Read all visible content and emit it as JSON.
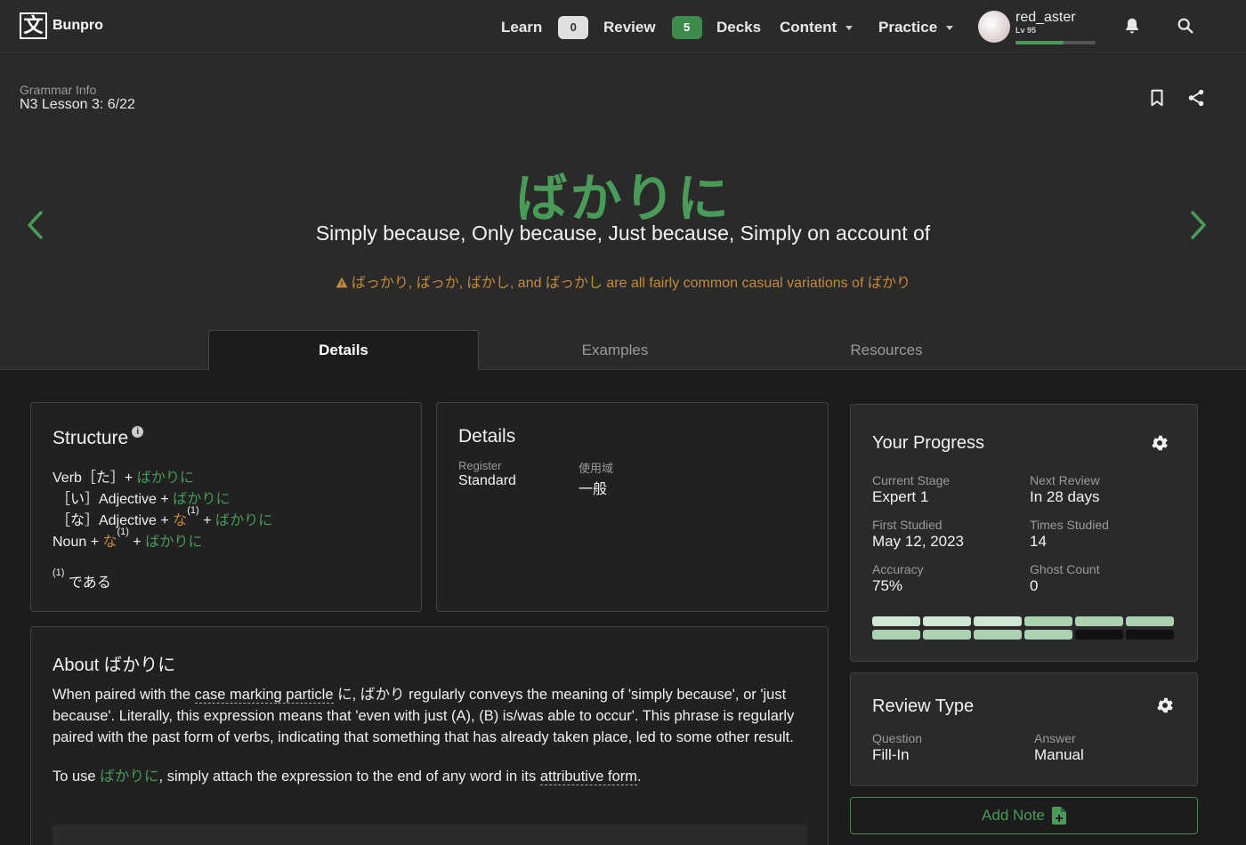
{
  "nav": {
    "brand": "Bunpro",
    "logo_glyph": "文",
    "learn_label": "Learn",
    "learn_count": "0",
    "review_label": "Review",
    "review_count": "5",
    "decks_label": "Decks",
    "content_label": "Content",
    "practice_label": "Practice",
    "username": "red_aster",
    "level": "Lv 95",
    "level_progress_percent": 60,
    "icons": [
      "bell-icon",
      "search-icon"
    ]
  },
  "header": {
    "info_label": "Grammar Info",
    "lesson": "N3 Lesson 3: 6/22",
    "grammar_point": "ばかりに",
    "meaning": "Simply because, Only because, Just because, Simply on account of",
    "warning": "ばっかり, ばっか, ばかし, and ばっかし are all fairly common casual variations of ばかり",
    "icons": [
      "bookmark-icon",
      "share-icon",
      "chevron-left-icon",
      "chevron-right-icon",
      "warning-icon"
    ]
  },
  "tabs": [
    {
      "label": "Details",
      "active": true
    },
    {
      "label": "Examples",
      "active": false
    },
    {
      "label": "Resources",
      "active": false
    }
  ],
  "structure": {
    "title": "Structure",
    "info": "i",
    "line1_pre": "Verb［た］+ ",
    "line2_pre": "［い］Adjective + ",
    "line3_pre": "［な］Adjective + ",
    "line4_pre": "Noun + ",
    "na": "な",
    "sup": "(1)",
    "plus": " + ",
    "grammar": "ばかりに",
    "footnote_mark": "(1)",
    "footnote_text": " である"
  },
  "details": {
    "title": "Details",
    "register_label": "Register",
    "register_value": "Standard",
    "usage_label": "使用域",
    "usage_value": "一般"
  },
  "about": {
    "title": "About ばかりに",
    "p1_a": "When paired with the ",
    "p1_link": "case marking particle",
    "p1_b": " に, ばかり regularly conveys the meaning of 'simply because', or 'just because'. Literally, this expression means that 'even with just (A), (B) is/was able to occur'. This phrase is regularly paired with the past form of verbs, indicating that something that has already taken place, led to some other result.",
    "p2_a": "To use ",
    "p2_grammar": "ばかりに",
    "p2_b": ", simply attach the expression to the end of any word in its ",
    "p2_link": "attributive form",
    "p2_c": "."
  },
  "progress": {
    "title": "Your Progress",
    "current_stage_label": "Current Stage",
    "current_stage_value": "Expert 1",
    "next_review_label": "Next Review",
    "next_review_value": "In 28 days",
    "first_studied_label": "First Studied",
    "first_studied_value": "May 12, 2023",
    "times_studied_label": "Times Studied",
    "times_studied_value": "14",
    "accuracy_label": "Accuracy",
    "accuracy_value": "75%",
    "ghost_count_label": "Ghost Count",
    "ghost_count_value": "0",
    "srs_filled_segments": 10,
    "srs_total_segments": 12,
    "colors": {
      "light": "#cfe6d3",
      "mid": "#a9d2b0",
      "empty": "#111111"
    }
  },
  "review_type": {
    "title": "Review Type",
    "question_label": "Question",
    "question_value": "Fill-In",
    "answer_label": "Answer",
    "answer_value": "Manual"
  },
  "actions": {
    "add_note": "Add Note"
  },
  "colors": {
    "accent_green": "#4a9a5a",
    "warning_orange": "#c58a3a",
    "background": "#1c1c1c",
    "surface": "#2a2a2a"
  }
}
